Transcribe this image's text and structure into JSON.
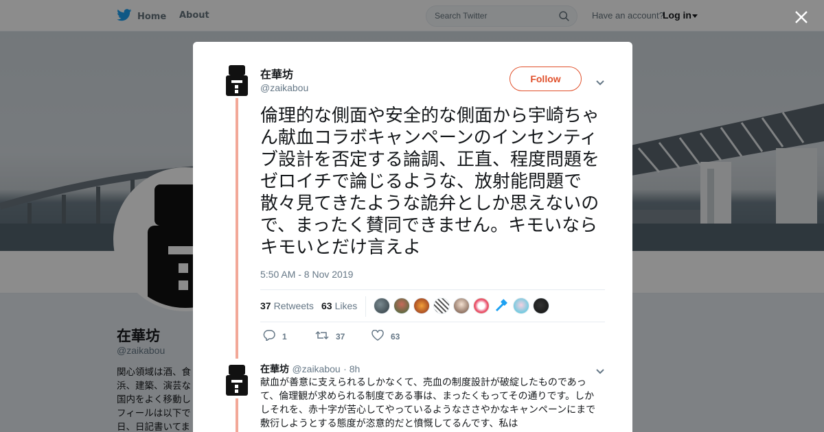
{
  "nav": {
    "home_label": "Home",
    "about_label": "About",
    "search_placeholder": "Search Twitter",
    "have_account": "Have an account?",
    "login_label": "Log in"
  },
  "profile": {
    "name": "在華坊",
    "handle": "@zaikabou",
    "bio_lines": [
      "関心領域は酒、食",
      "浜、建築、演芸な",
      "国内をよく移動し",
      "フィールは以下で",
      "日、日記書いてま"
    ]
  },
  "tweet": {
    "author_name": "在華坊",
    "author_handle": "@zaikabou",
    "follow_label": "Follow",
    "text": "倫理的な側面や安全的な側面から宇崎ちゃん献血コラボキャンペーンのインセンティブ設計を否定する論調、正直、程度問題をゼロイチで論じるような、放射能問題で散々見てきたような詭弁としか思えないので、まったく賛同できません。キモいならキモいとだけ言えよ",
    "timestamp": "5:50 AM - 8 Nov 2019",
    "retweets_count": "37",
    "retweets_label": "Retweets",
    "likes_count": "63",
    "likes_label": "Likes",
    "reply_count": "1",
    "retweet_action_count": "37",
    "like_action_count": "63"
  },
  "reply": {
    "author_name": "在華坊",
    "author_handle": "@zaikabou",
    "age": "· 8h",
    "text": "献血が善意に支えられるしかなくて、売血の制度設計が破綻したものであって、倫理観が求められる制度である事は、まったくもってその通りです。しかしそれを、赤十字が苦心してやっているようなささやかなキャンペーンにまで敷衍しようとする態度が恣意的だと憤慨してるんです、私は"
  },
  "colors": {
    "twitter_blue": "#1da1f2",
    "follow_accent": "#e0502b",
    "thread_line": "#f2a898"
  },
  "icons": {
    "logo": "twitter-bird-icon",
    "search": "search-icon",
    "close": "close-icon",
    "reply": "reply-icon",
    "retweet": "retweet-icon",
    "like": "heart-icon",
    "menu": "chevron-down-icon"
  }
}
